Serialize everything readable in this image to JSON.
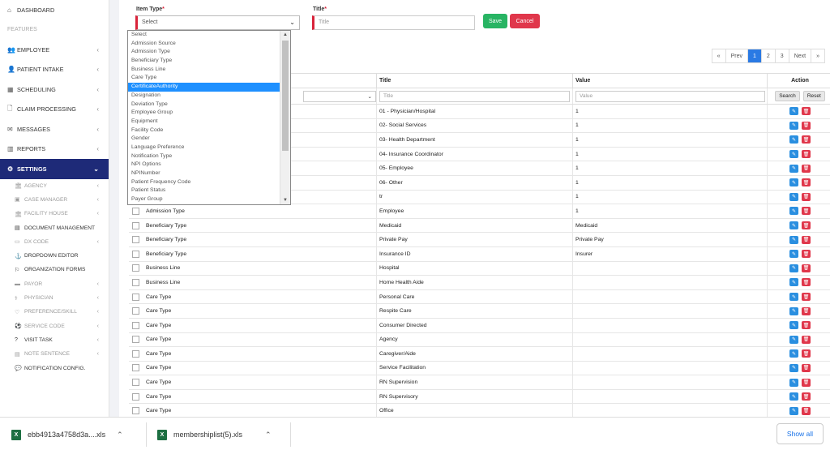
{
  "sidebar": {
    "items": [
      {
        "icon": "home-icon",
        "glyph": "⌂",
        "label": "DASHBOARD"
      },
      {
        "label": "FEATURES"
      },
      {
        "icon": "users-icon",
        "glyph": "👥",
        "label": "EMPLOYEE"
      },
      {
        "icon": "user-icon",
        "glyph": "👤",
        "label": "PATIENT INTAKE"
      },
      {
        "icon": "calendar-icon",
        "glyph": "▦",
        "label": "SCHEDULING"
      },
      {
        "icon": "file-icon",
        "glyph": "🗋",
        "label": "CLAIM PROCESSING"
      },
      {
        "icon": "envelope-icon",
        "glyph": "✉",
        "label": "MESSAGES"
      },
      {
        "icon": "bar-chart-icon",
        "glyph": "▥",
        "label": "REPORTS"
      },
      {
        "icon": "gear-icon",
        "glyph": "⚙",
        "label": "SETTINGS"
      }
    ],
    "sub_items": [
      {
        "icon": "bank-icon",
        "glyph": "🏛",
        "label": "AGENCY"
      },
      {
        "icon": "folder-icon",
        "glyph": "▣",
        "label": "CASE MANAGER"
      },
      {
        "icon": "bank-icon",
        "glyph": "🏛",
        "label": "FACILITY HOUSE"
      },
      {
        "icon": "document-icon",
        "glyph": "▤",
        "label": "DOCUMENT MANAGEMENT"
      },
      {
        "icon": "code-icon",
        "glyph": "▭",
        "label": "DX CODE"
      },
      {
        "icon": "anchor-icon",
        "glyph": "⚓",
        "label": "DROPDOWN EDITOR"
      },
      {
        "icon": "flag-icon",
        "glyph": "⚐",
        "label": "ORGANIZATION FORMS"
      },
      {
        "icon": "money-icon",
        "glyph": "▬",
        "label": "PAYOR"
      },
      {
        "icon": "stethoscope-icon",
        "glyph": "⚕",
        "label": "PHYSICIAN"
      },
      {
        "icon": "heart-icon",
        "glyph": "♡",
        "label": "PREFERENCE/SKILL"
      },
      {
        "icon": "soccer-ball-icon",
        "glyph": "⚽",
        "label": "SERVICE CODE"
      },
      {
        "icon": "question-icon",
        "glyph": "?",
        "label": "VISIT TASK"
      },
      {
        "icon": "note-icon",
        "glyph": "▤",
        "label": "NOTE SENTENCE"
      },
      {
        "icon": "chat-icon",
        "glyph": "💬",
        "label": "NOTIFICATION CONFIG."
      }
    ]
  },
  "form": {
    "item_type_label": "Item Type",
    "title_label": "Title",
    "required_mark": "*",
    "select_value": "Select",
    "title_placeholder": "Title",
    "save_label": "Save",
    "cancel_label": "Cancel"
  },
  "dropdown_options": [
    "Select",
    "Admission Source",
    "Admission Type",
    "Beneficiary Type",
    "Business Line",
    "Care Type",
    "CertificateAuthority",
    "Designation",
    "Deviation Type",
    "Employee Group",
    "Equipment",
    "Facility Code",
    "Gender",
    "Language Preference",
    "Notification Type",
    "NPI Options",
    "NPINumber",
    "Patient Frequency Code",
    "Patient Status",
    "Payer Group"
  ],
  "dropdown_selected_index": 6,
  "pagination": {
    "first": "«",
    "prev": "Prev",
    "pages": [
      "1",
      "2",
      "3"
    ],
    "next": "Next",
    "last": "»",
    "active": "1"
  },
  "table": {
    "headers": {
      "title": "Title",
      "value": "Value",
      "action": "Action"
    },
    "filters": {
      "title_placeholder": "Title",
      "value_placeholder": "Value",
      "search": "Search",
      "reset": "Reset"
    },
    "rows": [
      {
        "item": "",
        "title": "01 - Physician/Hospital",
        "value": "1"
      },
      {
        "item": "",
        "title": "02- Social Services",
        "value": "1"
      },
      {
        "item": "",
        "title": "03- Health Department",
        "value": "1"
      },
      {
        "item": "",
        "title": "04- Insurance Coordinator",
        "value": "1"
      },
      {
        "item": "",
        "title": "05- Employee",
        "value": "1"
      },
      {
        "item": "",
        "title": "06- Other",
        "value": "1"
      },
      {
        "item": "",
        "title": "tr",
        "value": "1"
      },
      {
        "item": "Admission Type",
        "title": "Employee",
        "value": "1"
      },
      {
        "item": "Beneficiary Type",
        "title": "Medicaid",
        "value": "Medicaid"
      },
      {
        "item": "Beneficiary Type",
        "title": "Private Pay",
        "value": "Private Pay"
      },
      {
        "item": "Beneficiary Type",
        "title": "Insurance ID",
        "value": "Insurer"
      },
      {
        "item": "Business Line",
        "title": "Hospital",
        "value": ""
      },
      {
        "item": "Business Line",
        "title": "Home Health Aide",
        "value": ""
      },
      {
        "item": "Care Type",
        "title": "Personal Care",
        "value": ""
      },
      {
        "item": "Care Type",
        "title": "Respite Care",
        "value": ""
      },
      {
        "item": "Care Type",
        "title": "Consumer Directed",
        "value": ""
      },
      {
        "item": "Care Type",
        "title": "Agency",
        "value": ""
      },
      {
        "item": "Care Type",
        "title": "Caregiver/Aide",
        "value": ""
      },
      {
        "item": "Care Type",
        "title": "Service Facilitation",
        "value": ""
      },
      {
        "item": "Care Type",
        "title": "RN Supervision",
        "value": ""
      },
      {
        "item": "Care Type",
        "title": "RN Supervisory",
        "value": ""
      },
      {
        "item": "Care Type",
        "title": "Office",
        "value": ""
      }
    ]
  },
  "downloads": {
    "file1": "ebb4913a4758d3a....xls",
    "file2": "membershiplist(5).xls",
    "show_all": "Show all"
  },
  "colors": {
    "active_nav": "#1e2a78",
    "save": "#28b463",
    "cancel": "#e0374b",
    "edit": "#2a8fe0",
    "delete": "#e0374b",
    "pager_active": "#2a7ae4"
  }
}
